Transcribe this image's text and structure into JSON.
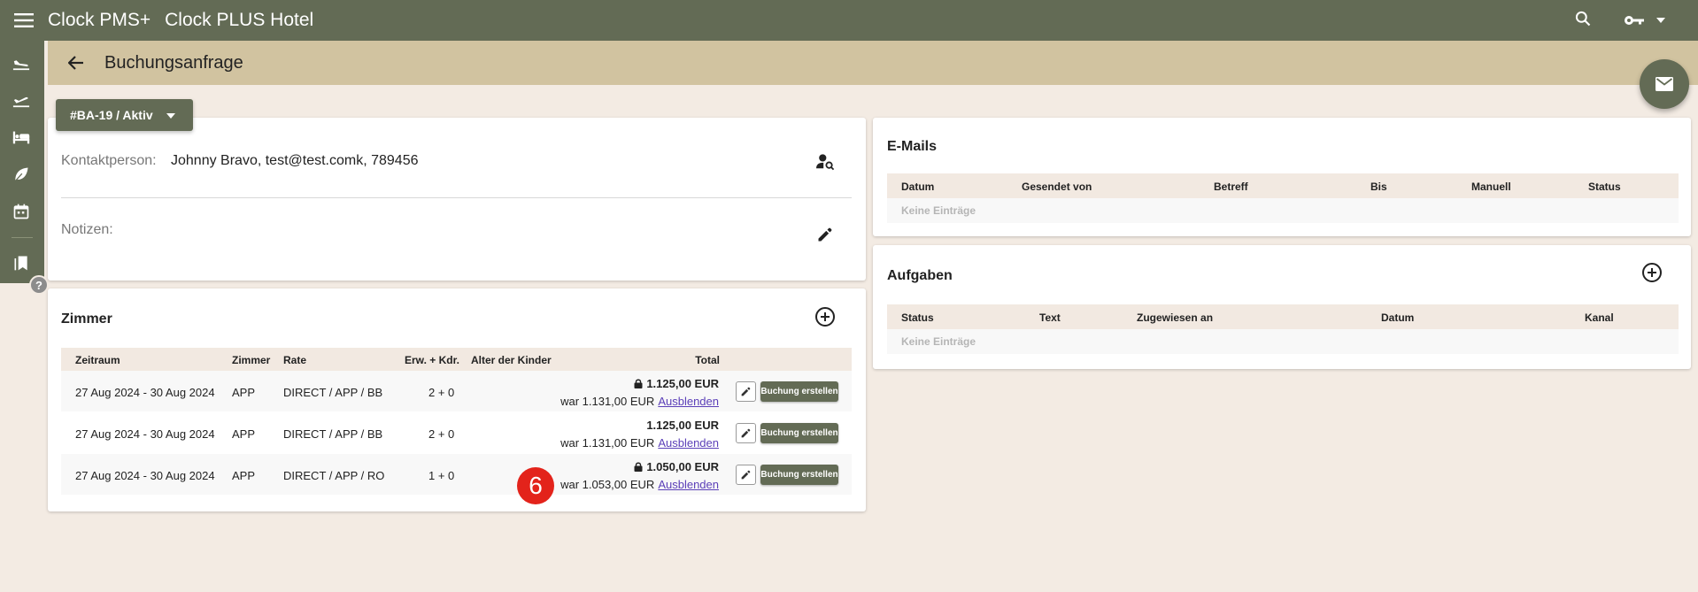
{
  "app": {
    "name": "Clock PMS+",
    "hotel": "Clock PLUS Hotel"
  },
  "icons": {
    "menu": "menu-icon",
    "search": "search-icon",
    "key": "key-icon",
    "dropdown": "arrow-drop-down-icon",
    "sidenav": [
      "flight-land-icon",
      "flight-takeoff-icon",
      "bed-icon",
      "leaf-icon",
      "calendar-icon",
      "bookmarks-icon"
    ],
    "help": "help-icon",
    "back": "arrow-back-icon",
    "mail": "mail-icon"
  },
  "colors": {
    "topbar": "#636b55",
    "pagebar": "#d1c3a0",
    "background": "#f3ebe3",
    "link": "#5b3fb8",
    "badge": "#e3231b"
  },
  "help_label": "?",
  "page": {
    "title": "Buchungsanfrage"
  },
  "status_button": {
    "label": "#BA-19 / Aktiv"
  },
  "contact": {
    "label": "Kontaktperson:",
    "value": "Johnny Bravo, test@test.comk, 789456",
    "notes_label": "Notizen:"
  },
  "rooms": {
    "title": "Zimmer",
    "headers": {
      "zeitraum": "Zeitraum",
      "zimmer": "Zimmer",
      "rate": "Rate",
      "erw": "Erw. + Kdr.",
      "alter": "Alter der Kinder",
      "total": "Total"
    },
    "rows": [
      {
        "zeitraum": "27 Aug 2024 - 30 Aug 2024",
        "zimmer": "APP",
        "rate": "DIRECT / APP / BB",
        "erw": "2 + 0",
        "locked": true,
        "total": "1.125,00 EUR",
        "was": "war 1.131,00 EUR",
        "hide": "Ausblenden",
        "action": "Buchung erstellen"
      },
      {
        "zeitraum": "27 Aug 2024 - 30 Aug 2024",
        "zimmer": "APP",
        "rate": "DIRECT / APP / BB",
        "erw": "2 + 0",
        "locked": false,
        "total": "1.125,00 EUR",
        "was": "war 1.131,00 EUR",
        "hide": "Ausblenden",
        "action": "Buchung erstellen"
      },
      {
        "zeitraum": "27 Aug 2024 - 30 Aug 2024",
        "zimmer": "APP",
        "rate": "DIRECT / APP / RO",
        "erw": "1 + 0",
        "locked": true,
        "total": "1.050,00 EUR",
        "was": "war 1.053,00 EUR",
        "hide": "Ausblenden",
        "action": "Buchung erstellen"
      }
    ]
  },
  "emails": {
    "title": "E-Mails",
    "headers": {
      "datum": "Datum",
      "gesendet": "Gesendet von",
      "betreff": "Betreff",
      "bis": "Bis",
      "manuell": "Manuell",
      "status": "Status"
    },
    "empty": "Keine Einträge"
  },
  "tasks": {
    "title": "Aufgaben",
    "headers": {
      "status": "Status",
      "text": "Text",
      "zugewiesen": "Zugewiesen an",
      "datum": "Datum",
      "kanal": "Kanal"
    },
    "empty": "Keine Einträge"
  },
  "badge": {
    "value": "6"
  }
}
